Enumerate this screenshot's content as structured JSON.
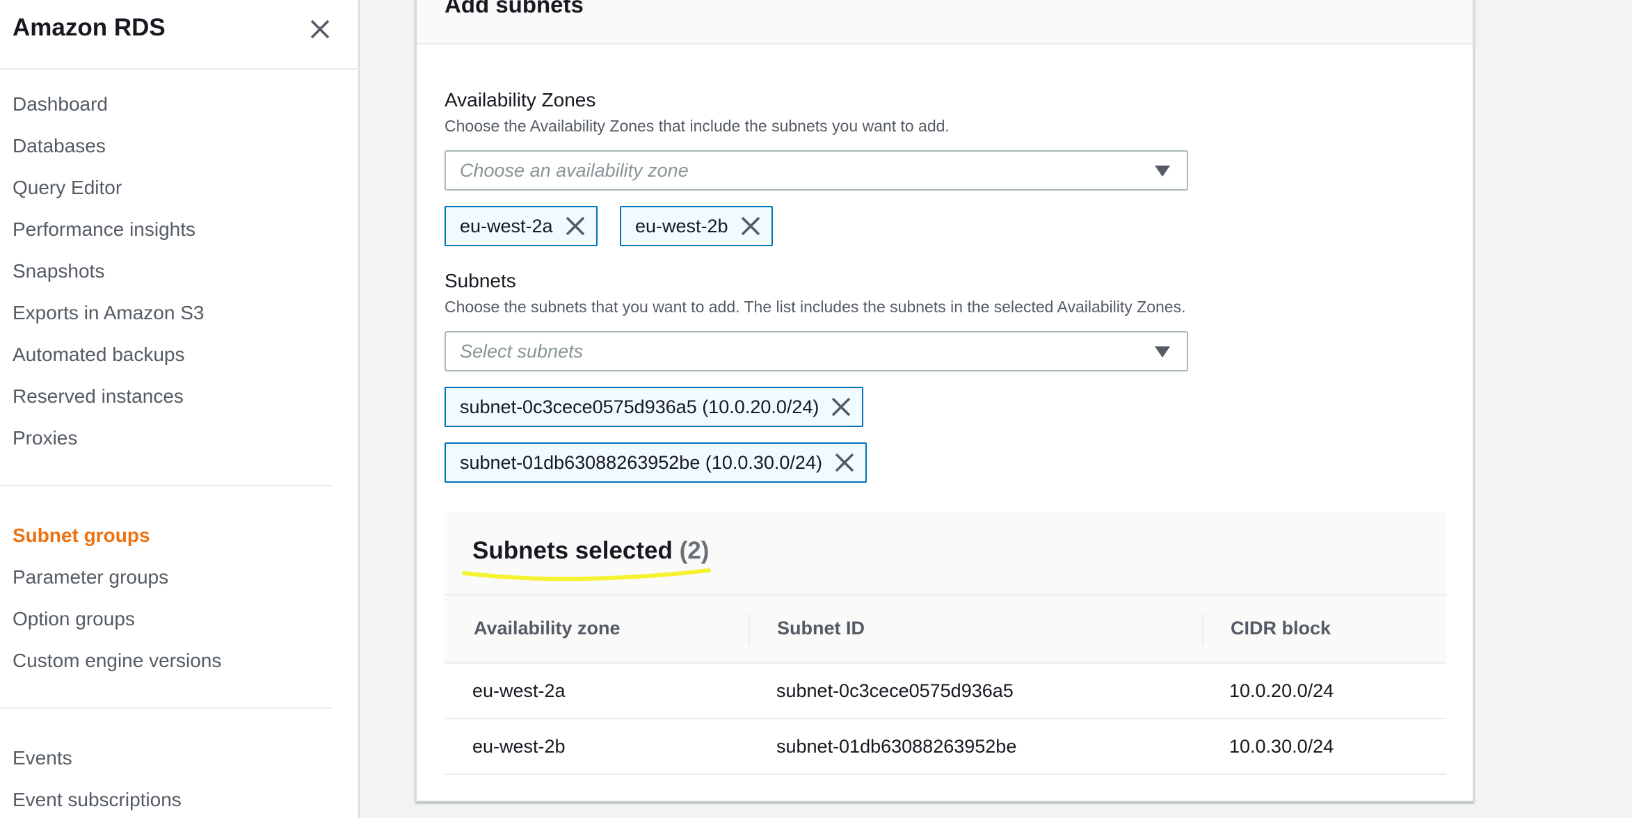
{
  "sidebar": {
    "title": "Amazon RDS",
    "items": [
      {
        "label": "Dashboard"
      },
      {
        "label": "Databases"
      },
      {
        "label": "Query Editor"
      },
      {
        "label": "Performance insights"
      },
      {
        "label": "Snapshots"
      },
      {
        "label": "Exports in Amazon S3"
      },
      {
        "label": "Automated backups"
      },
      {
        "label": "Reserved instances"
      },
      {
        "label": "Proxies"
      },
      {
        "label": "Subnet groups"
      },
      {
        "label": "Parameter groups"
      },
      {
        "label": "Option groups"
      },
      {
        "label": "Custom engine versions"
      },
      {
        "label": "Events"
      },
      {
        "label": "Event subscriptions"
      }
    ],
    "active_item": "Subnet groups"
  },
  "panel": {
    "title": "Add subnets",
    "availability_zones": {
      "label": "Availability Zones",
      "description": "Choose the Availability Zones that include the subnets you want to add.",
      "placeholder": "Choose an availability zone",
      "tokens": [
        "eu-west-2a",
        "eu-west-2b"
      ]
    },
    "subnets": {
      "label": "Subnets",
      "description": "Choose the subnets that you want to add. The list includes the subnets in the selected Availability Zones.",
      "placeholder": "Select subnets",
      "tokens": [
        "subnet-0c3cece0575d936a5 (10.0.20.0/24)",
        "subnet-01db63088263952be (10.0.30.0/24)"
      ]
    },
    "selected": {
      "title": "Subnets selected",
      "count": "(2)",
      "columns": [
        "Availability zone",
        "Subnet ID",
        "CIDR block"
      ],
      "rows": [
        [
          "eu-west-2a",
          "subnet-0c3cece0575d936a5",
          "10.0.20.0/24"
        ],
        [
          "eu-west-2b",
          "subnet-01db63088263952be",
          "10.0.30.0/24"
        ]
      ]
    }
  },
  "colors": {
    "accent_orange": "#ec7211",
    "token_border": "#0073bb",
    "token_bg": "#f1faff",
    "highlight_yellow": "#f5f230"
  },
  "icons": {
    "sidebar_close": "close-icon",
    "token_remove": "close-icon",
    "dropdown": "caret-down-icon"
  }
}
